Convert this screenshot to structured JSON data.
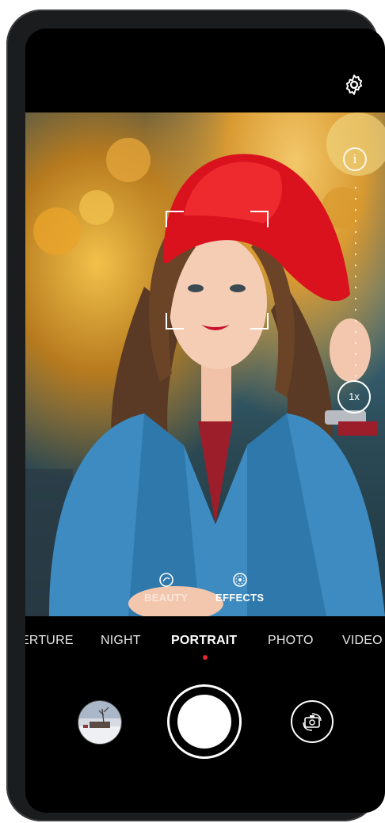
{
  "camera": {
    "settings_icon": "gear-icon",
    "info_icon_glyph": "i",
    "zoom_level": "1x",
    "beauty_label": "BEAUTY",
    "effects_label": "EFFECTS",
    "modes": [
      "ERTURE",
      "NIGHT",
      "PORTRAIT",
      "PHOTO",
      "VIDEO"
    ],
    "active_mode": "PORTRAIT",
    "accent_color": "#e5262b"
  }
}
